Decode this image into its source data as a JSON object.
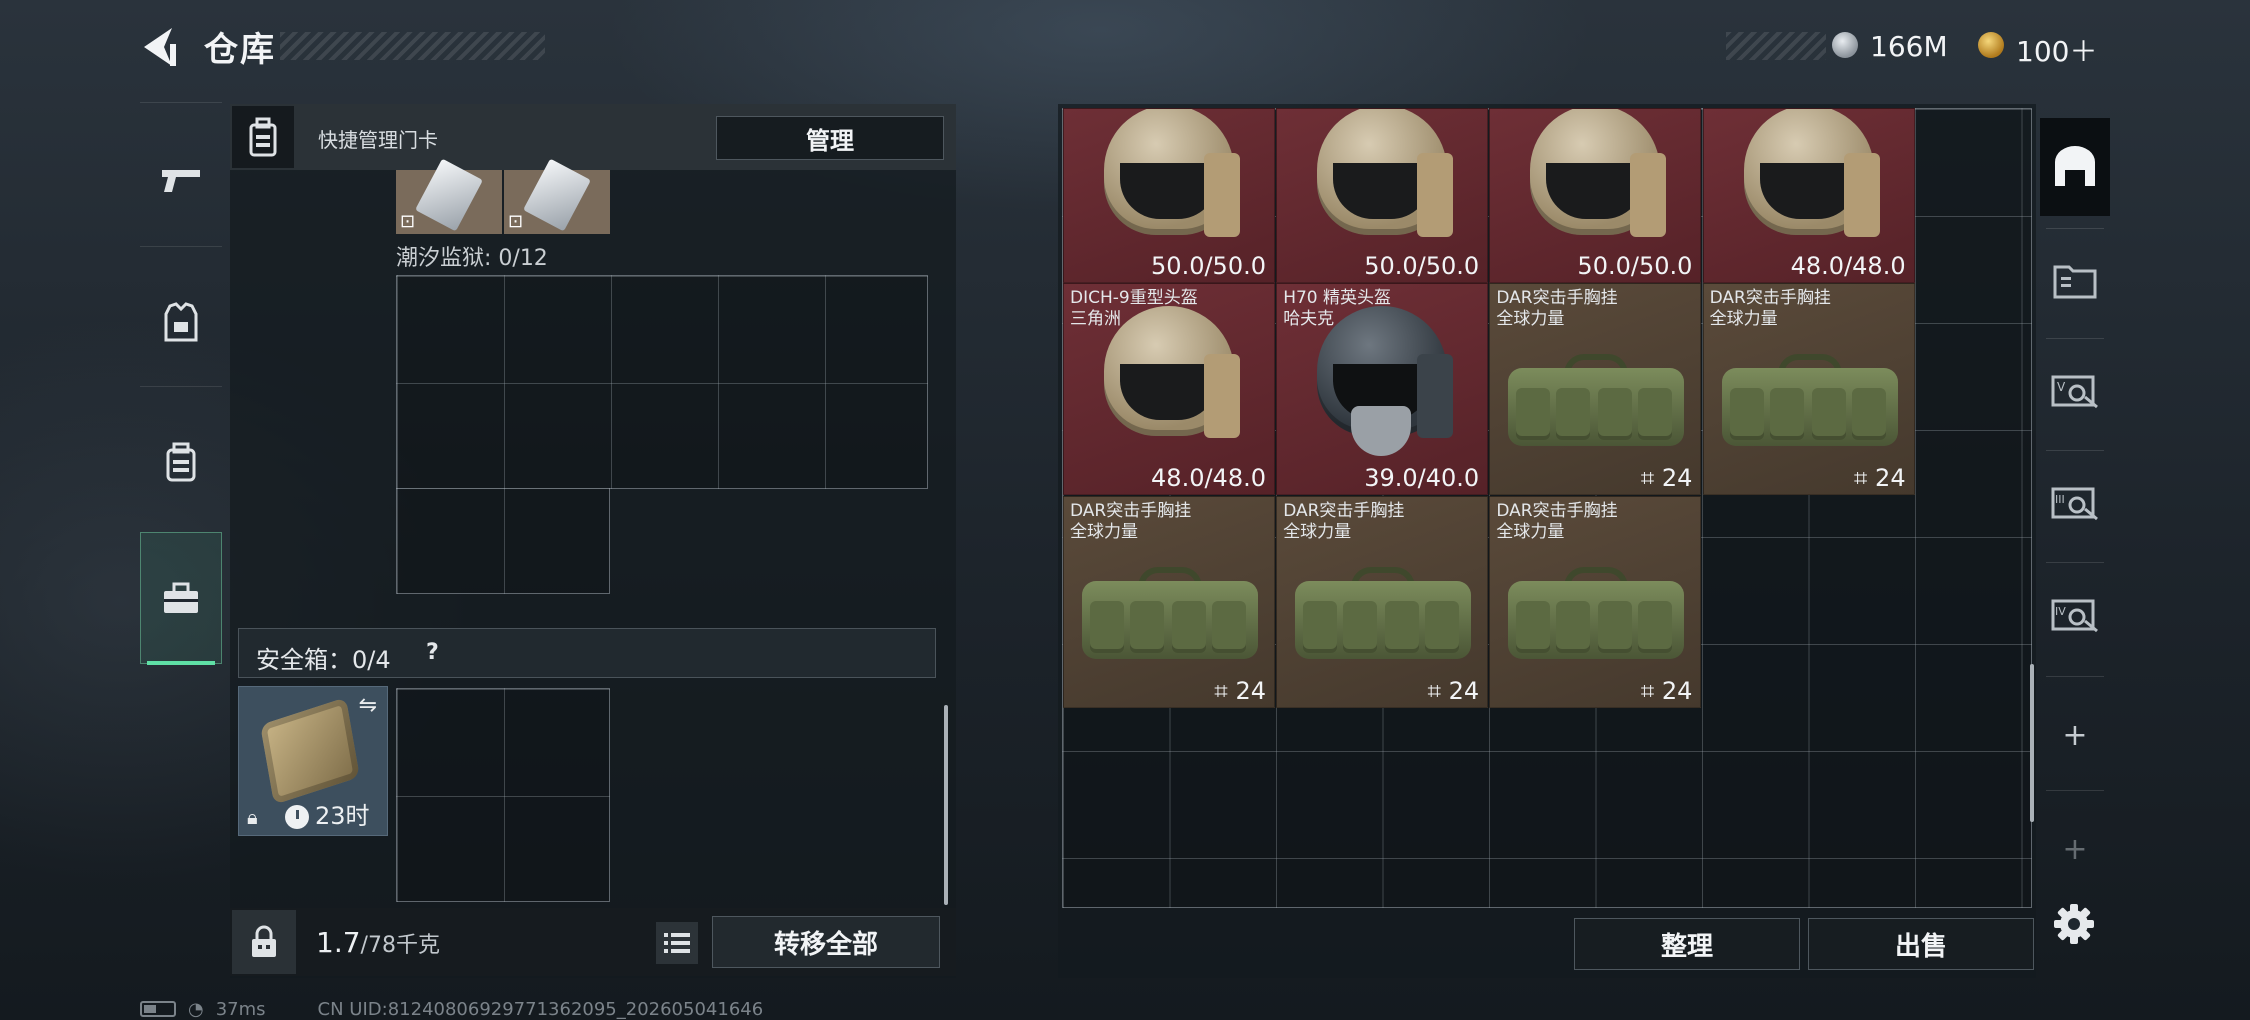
{
  "header": {
    "title": "仓库",
    "currencies": [
      {
        "icon": "silver-coin-icon",
        "value": "166M"
      },
      {
        "icon": "gold-coin-icon",
        "value": "100＋"
      }
    ]
  },
  "left_tabs": [
    {
      "icon": "pistol-icon"
    },
    {
      "icon": "armor-vest-icon"
    },
    {
      "icon": "backpack-icon"
    },
    {
      "icon": "toolbox-icon",
      "active": true
    }
  ],
  "keycards": {
    "title": "快捷管理门卡",
    "manage_label": "管理",
    "items": [
      {
        "icon": "keycard-icon",
        "badge": "⊡"
      },
      {
        "icon": "keycard-icon",
        "badge": "⊡"
      }
    ],
    "prison_label": "潮汐监狱: 0/12"
  },
  "safe_box": {
    "label": "安全箱：0/4",
    "help": "?",
    "case_time": "23时",
    "swap_icon": "⇋"
  },
  "bottom": {
    "weight": "1.7",
    "weight_cap": "/78千克",
    "transfer_label": "转移全部"
  },
  "status": {
    "ping": "37ms",
    "uid": "CN UID:81240806929771362095_202605041646"
  },
  "stash": {
    "items": [
      {
        "row": 0,
        "col": 0,
        "kind": "helmet",
        "color": "red",
        "name": "",
        "sub": "",
        "value": "50.0/50.0"
      },
      {
        "row": 0,
        "col": 1,
        "kind": "helmet",
        "color": "red",
        "name": "",
        "sub": "",
        "value": "50.0/50.0"
      },
      {
        "row": 0,
        "col": 2,
        "kind": "helmet",
        "color": "red",
        "name": "",
        "sub": "",
        "value": "50.0/50.0"
      },
      {
        "row": 0,
        "col": 3,
        "kind": "helmet",
        "color": "red",
        "name": "",
        "sub": "",
        "value": "48.0/48.0"
      },
      {
        "row": 1,
        "col": 0,
        "kind": "helmet",
        "color": "red",
        "name": "DICH-9重型头盔",
        "sub": "三角洲",
        "value": "48.0/48.0"
      },
      {
        "row": 1,
        "col": 1,
        "kind": "helmet-dark",
        "color": "red",
        "name": "H70 精英头盔",
        "sub": "哈夫克",
        "value": "39.0/40.0"
      },
      {
        "row": 1,
        "col": 2,
        "kind": "bag",
        "color": "brown",
        "name": "DAR突击手胸挂",
        "sub": "全球力量",
        "count": "24"
      },
      {
        "row": 1,
        "col": 3,
        "kind": "bag",
        "color": "brown",
        "name": "DAR突击手胸挂",
        "sub": "全球力量",
        "count": "24"
      },
      {
        "row": 2,
        "col": 0,
        "kind": "bag",
        "color": "brown",
        "name": "DAR突击手胸挂",
        "sub": "全球力量",
        "count": "24"
      },
      {
        "row": 2,
        "col": 1,
        "kind": "bag",
        "color": "brown",
        "name": "DAR突击手胸挂",
        "sub": "全球力量",
        "count": "24"
      },
      {
        "row": 2,
        "col": 2,
        "kind": "bag",
        "color": "brown",
        "name": "DAR突击手胸挂",
        "sub": "全球力量",
        "count": "24"
      }
    ],
    "sort_label": "整理",
    "sell_label": "出售"
  },
  "right_tabs": [
    {
      "icon": "stash-home-icon",
      "active": true
    },
    {
      "icon": "stash-folder-icon"
    },
    {
      "icon": "stash-v-icon"
    },
    {
      "icon": "stash-iii-icon"
    },
    {
      "icon": "stash-iv-icon"
    },
    {
      "icon": "add-stash-icon",
      "label": "+"
    },
    {
      "icon": "add-stash-icon",
      "label": "+"
    }
  ]
}
